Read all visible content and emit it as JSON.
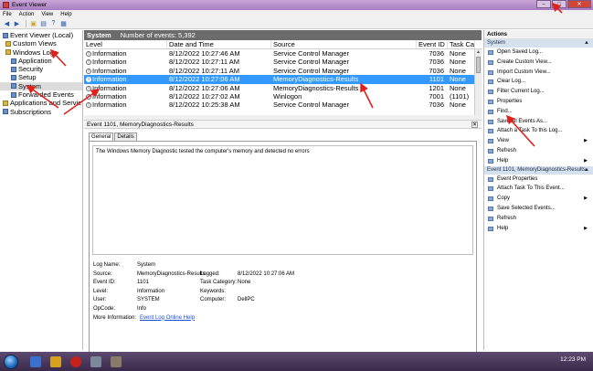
{
  "window": {
    "title": "Event Viewer"
  },
  "menu": [
    "File",
    "Action",
    "View",
    "Help"
  ],
  "tree": [
    {
      "label": "Event Viewer (Local)",
      "icon": "computer-icon"
    },
    {
      "label": "Custom Views",
      "icon": "folder-icon"
    },
    {
      "label": "Windows Logs",
      "icon": "folder-icon"
    },
    {
      "label": "Application",
      "icon": "log-icon"
    },
    {
      "label": "Security",
      "icon": "log-icon"
    },
    {
      "label": "Setup",
      "icon": "log-icon"
    },
    {
      "label": "System",
      "icon": "log-icon"
    },
    {
      "label": "Forwarded Events",
      "icon": "log-icon"
    },
    {
      "label": "Applications and Servic",
      "icon": "folder-icon"
    },
    {
      "label": "Subscriptions",
      "icon": "subscription-icon"
    }
  ],
  "log": {
    "name": "System",
    "count_label": "Number of events: 5,392"
  },
  "columns": [
    "Level",
    "Date and Time",
    "Source",
    "Event ID",
    "Task Ca"
  ],
  "events": [
    {
      "level": "Information",
      "date": "8/12/2022 10:27:46 AM",
      "source": "Service Control Manager",
      "id": "7036",
      "task": "None"
    },
    {
      "level": "Information",
      "date": "8/12/2022 10:27:11 AM",
      "source": "Service Control Manager",
      "id": "7036",
      "task": "None"
    },
    {
      "level": "Information",
      "date": "8/12/2022 10:27:11 AM",
      "source": "Service Control Manager",
      "id": "7036",
      "task": "None"
    },
    {
      "level": "Information",
      "date": "8/12/2022 10:27:06 AM",
      "source": "MemoryDiagnostics-Results",
      "id": "1101",
      "task": "None"
    },
    {
      "level": "Information",
      "date": "8/12/2022 10:27:06 AM",
      "source": "MemoryDiagnostics-Results",
      "id": "1201",
      "task": "None"
    },
    {
      "level": "Information",
      "date": "8/12/2022 10:27:02 AM",
      "source": "Winlogon",
      "id": "7001",
      "task": "(1101)"
    },
    {
      "level": "Information",
      "date": "8/12/2022 10:25:38 AM",
      "source": "Service Control Manager",
      "id": "7036",
      "task": "None"
    }
  ],
  "detail": {
    "header": "Event 1101, MemoryDiagnostics-Results",
    "tabs": [
      "General",
      "Details"
    ],
    "description": "The Windows Memory Diagnostic tested the computer's memory and detected no errors",
    "log_name_label": "Log Name:",
    "log_name": "System",
    "source_label": "Source:",
    "source": "MemoryDiagnostics-Results",
    "logged_label": "Logged:",
    "logged": "8/12/2022 10:27:06 AM",
    "event_id_label": "Event ID:",
    "event_id": "1101",
    "task_label": "Task Category:",
    "task": "None",
    "level_label": "Level:",
    "level": "Information",
    "keywords_label": "Keywords:",
    "keywords": "",
    "user_label": "User:",
    "user": "SYSTEM",
    "computer_label": "Computer:",
    "computer": "DellPC",
    "opcode_label": "OpCode:",
    "opcode": "Info",
    "more_label": "More Information:",
    "more_link": "Event Log Online Help"
  },
  "actions": {
    "title": "Actions",
    "section1": "System",
    "items1": [
      {
        "label": "Open Saved Log...",
        "sub": false
      },
      {
        "label": "Create Custom View...",
        "sub": false
      },
      {
        "label": "Import Custom View...",
        "sub": false
      },
      {
        "label": "Clear Log...",
        "sub": false
      },
      {
        "label": "Filter Current Log...",
        "sub": false
      },
      {
        "label": "Properties",
        "sub": false
      },
      {
        "label": "Find...",
        "sub": false
      },
      {
        "label": "Save All Events As...",
        "sub": false
      },
      {
        "label": "Attach a Task To this Log...",
        "sub": false
      },
      {
        "label": "View",
        "sub": true
      },
      {
        "label": "Refresh",
        "sub": false
      },
      {
        "label": "Help",
        "sub": true
      }
    ],
    "section2": "Event 1101, MemoryDiagnostics-Results",
    "items2": [
      {
        "label": "Event Properties",
        "sub": false
      },
      {
        "label": "Attach Task To This Event...",
        "sub": false
      },
      {
        "label": "Copy",
        "sub": true
      },
      {
        "label": "Save Selected Events...",
        "sub": false
      },
      {
        "label": "Refresh",
        "sub": false
      },
      {
        "label": "Help",
        "sub": true
      }
    ]
  },
  "taskbar": {
    "clock": "12:23 PM"
  },
  "colors": {
    "selection": "#3399ff",
    "annotation_arrow": "#e0201a",
    "titlebar": "#b48ccb"
  }
}
